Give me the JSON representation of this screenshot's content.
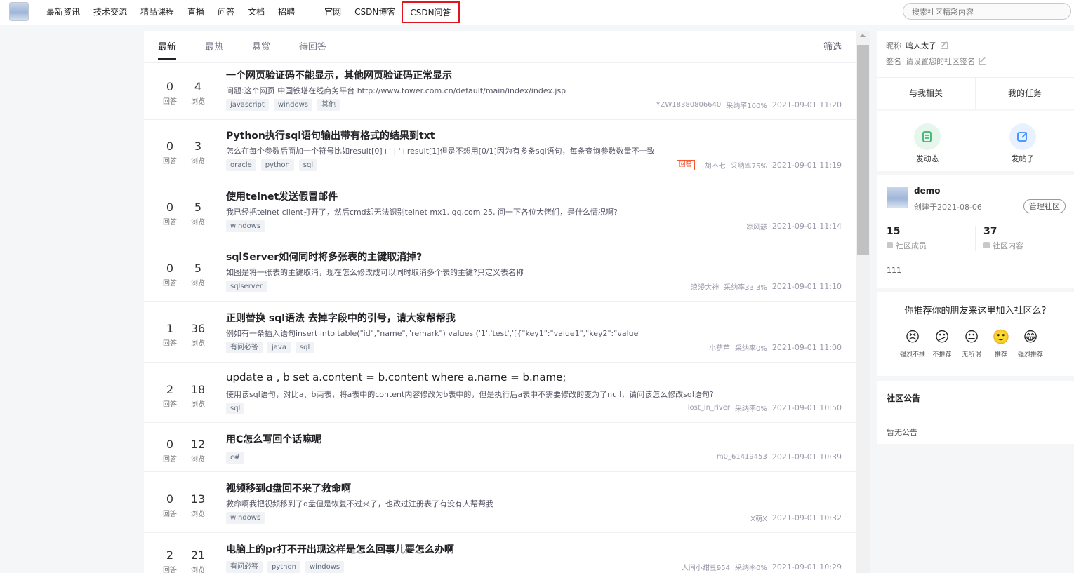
{
  "nav": {
    "items": [
      "最新资讯",
      "技术交流",
      "精品课程",
      "直播",
      "问答",
      "文档",
      "招聘"
    ],
    "items2": [
      "官网",
      "CSDN博客"
    ],
    "highlight": "CSDN问答"
  },
  "search": {
    "placeholder": "搜索社区精彩内容"
  },
  "tabs": [
    "最新",
    "最热",
    "悬赏",
    "待回答"
  ],
  "filter": "筛选",
  "stat_labels": {
    "answers": "回答",
    "views": "浏览"
  },
  "questions": [
    {
      "answers": "0",
      "views": "4",
      "title": "一个网页验证码不能显示，其他网页验证码正常显示",
      "desc": "问题:这个网页 中国铁塔在线商务平台 http://www.tower.com.cn/default/main/index/index.jsp",
      "tags": [
        "javascript",
        "windows",
        "其他"
      ],
      "badge": "",
      "author": "YZW18380806640",
      "rate": "采纳率100%",
      "time": "2021-09-01 11:20"
    },
    {
      "answers": "0",
      "views": "3",
      "title": "Python执行sql语句输出带有格式的结果到txt",
      "desc": "怎么在每个参数后面加一个符号比如result[0]+' | '+result[1]但是不想用[0/1]因为有多条sql语句，每条查询参数数量不一致",
      "tags": [
        "oracle",
        "python",
        "sql"
      ],
      "badge": "回答",
      "author": "胡不七",
      "rate": "采纳率75%",
      "time": "2021-09-01 11:19"
    },
    {
      "answers": "0",
      "views": "5",
      "title": "使用telnet发送假冒邮件",
      "desc": "我已经把telnet client打开了，然后cmd却无法识别telnet mx1. qq.com 25, 问一下各位大佬们，是什么情况啊?",
      "tags": [
        "windows"
      ],
      "badge": "",
      "author": "凉风瑟",
      "rate": "",
      "time": "2021-09-01 11:14"
    },
    {
      "answers": "0",
      "views": "5",
      "title": "sqlServer如何同时将多张表的主键取消掉?",
      "desc": "如图是将一张表的主键取消，现在怎么修改成可以同时取消多个表的主键?只定义表名称",
      "tags": [
        "sqlserver"
      ],
      "badge": "",
      "author": "浪漫大神",
      "rate": "采纳率33.3%",
      "time": "2021-09-01 11:10"
    },
    {
      "answers": "1",
      "views": "36",
      "title": "正则替换 sql语法 去掉字段中的引号，请大家帮帮我",
      "desc": "例如有一条插入语句insert into table(\"id\",\"name\",\"remark\") values ('1','test','[{\"key1\":\"value1\",\"key2\":\"value",
      "tags": [
        "有问必答",
        "java",
        "sql"
      ],
      "badge": "",
      "author": "小葫芦",
      "rate": "采纳率0%",
      "time": "2021-09-01 11:00"
    },
    {
      "answers": "2",
      "views": "18",
      "title": "update a , b set a.content = b.content where a.name = b.name;",
      "desc": "使用该sql语句，对比a、b两表，将a表中的content内容修改为b表中的，但是执行后a表中不需要修改的变为了null，请问该怎么修改sql语句?",
      "tags": [
        "sql"
      ],
      "badge": "",
      "author": "lost_in_river",
      "rate": "采纳率0%",
      "time": "2021-09-01 10:50"
    },
    {
      "answers": "0",
      "views": "12",
      "title": "用C怎么写回个话嘛呢",
      "desc": "",
      "tags": [
        "c#"
      ],
      "badge": "",
      "author": "m0_61419453",
      "rate": "",
      "time": "2021-09-01 10:39"
    },
    {
      "answers": "0",
      "views": "13",
      "title": "视频移到d盘回不来了救命啊",
      "desc": "救命啊我把视频移到了d盘但是恢复不过来了，也改过注册表了有没有人帮帮我",
      "tags": [
        "windows"
      ],
      "badge": "",
      "author": "X萌X",
      "rate": "",
      "time": "2021-09-01 10:32"
    },
    {
      "answers": "2",
      "views": "21",
      "title": "电脑上的pr打不开出现这样是怎么回事儿要怎么办啊",
      "desc": "",
      "tags": [
        "有问必答",
        "python",
        "windows"
      ],
      "badge": "",
      "author": "人间小甜豆954",
      "rate": "采纳率0%",
      "time": "2021-09-01 10:29"
    }
  ],
  "profile": {
    "nick_label": "昵称",
    "nick": "鸣人太子",
    "sign_label": "签名",
    "sign": "请设置您的社区签名",
    "tab1": "与我相关",
    "tab2": "我的任务"
  },
  "actions": {
    "post_status": "发动态",
    "post_thread": "发帖子",
    "status_color": "#3cb371",
    "thread_color": "#3d8bff"
  },
  "community": {
    "name": "demo",
    "created": "创建于2021-08-06",
    "manage": "管理社区",
    "members": "15",
    "members_label": "社区成员",
    "contents": "37",
    "contents_label": "社区内容",
    "desc": "111"
  },
  "recommend": {
    "question": "你推荐你的朋友来这里加入社区么?",
    "options": [
      {
        "emoji": "😣",
        "label": "强烈不推"
      },
      {
        "emoji": "😕",
        "label": "不推荐"
      },
      {
        "emoji": "😐",
        "label": "无所谓"
      },
      {
        "emoji": "🙂",
        "label": "推荐"
      },
      {
        "emoji": "😁",
        "label": "强烈推荐"
      }
    ]
  },
  "notice": {
    "title": "社区公告",
    "body": "暂无公告"
  }
}
